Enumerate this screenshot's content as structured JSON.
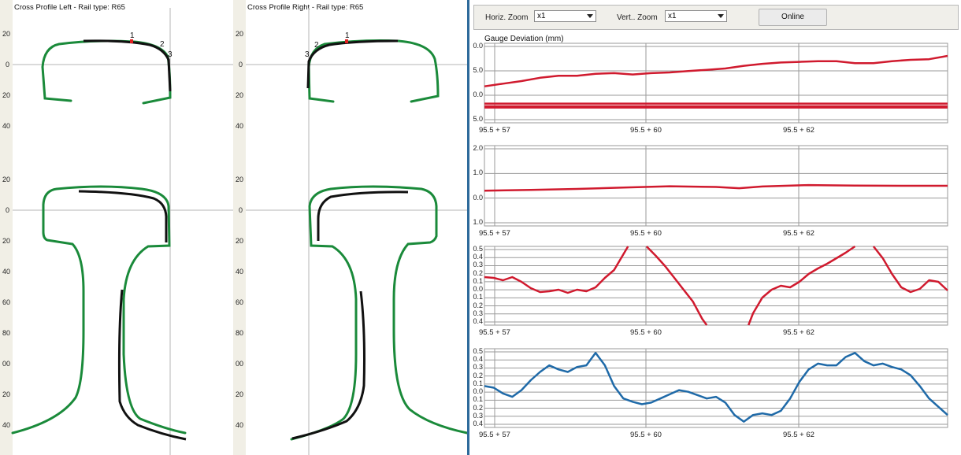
{
  "left_panel": {
    "title": "Cross Profile Left - Rail type: R65",
    "ticks_top": [
      "20",
      "0",
      "20",
      "40"
    ],
    "ticks_bottom": [
      "20",
      "0",
      "20",
      "40",
      "60",
      "80",
      "00",
      "20",
      "40"
    ],
    "markers": [
      "1",
      "2",
      "3"
    ]
  },
  "right_panel": {
    "title": "Cross Profile Right - Rail type: R65",
    "ticks_top": [
      "20",
      "0",
      "20",
      "40"
    ],
    "ticks_bottom": [
      "20",
      "0",
      "20",
      "40",
      "60",
      "80",
      "00",
      "20",
      "40"
    ],
    "markers": [
      "1",
      "2",
      "3"
    ]
  },
  "toolbar": {
    "horiz_label": "Horiz. Zoom",
    "horiz_value": "x1",
    "vert_label": "Vert.. Zoom",
    "vert_value": "x1",
    "online_label": "Online"
  },
  "colors": {
    "profile_green": "#1a8a3a",
    "measured_black": "#111111",
    "series_red": "#d01a2e",
    "series_blue": "#1f6aa8",
    "divider_blue": "#2d6a9b",
    "ruler_bg": "#f1efe6"
  },
  "chart_data": [
    {
      "type": "line",
      "title": "Gauge Deviation (mm)",
      "y_tick_labels": [
        "0.0",
        "5.0",
        "0.0",
        "5.0"
      ],
      "x_tick_labels": [
        "95.5 +  57",
        "95.5 +  60",
        "95.5 +  62"
      ],
      "series": [
        {
          "color": "#d01a2e",
          "x": [
            0,
            4,
            8,
            12,
            16,
            20,
            24,
            28,
            32,
            36,
            40,
            44,
            48,
            52,
            56,
            60,
            64,
            68,
            72,
            76,
            80,
            84,
            88,
            92,
            96,
            100
          ],
          "y": [
            2.0,
            2.4,
            2.8,
            3.3,
            3.6,
            3.6,
            3.9,
            4.0,
            3.8,
            4.0,
            4.1,
            4.3,
            4.5,
            4.7,
            5.1,
            5.4,
            5.6,
            5.7,
            5.8,
            5.8,
            5.5,
            5.5,
            5.8,
            6.0,
            6.1,
            6.6
          ]
        },
        {
          "color": "#d01a2e",
          "x": [
            0,
            100
          ],
          "y": [
            -0.6,
            -0.6
          ]
        },
        {
          "color": "#d01a2e",
          "x": [
            0,
            100
          ],
          "y": [
            -1.0,
            -1.0
          ]
        },
        {
          "color": "#d01a2e",
          "x": [
            0,
            100
          ],
          "y": [
            -1.2,
            -1.2
          ]
        }
      ]
    },
    {
      "type": "line",
      "y_tick_labels": [
        "2.0",
        "1.0",
        "0.0",
        "1.0"
      ],
      "x_tick_labels": [
        "95.5 +  57",
        "95.5 +  60",
        "95.5 +  62"
      ],
      "series": [
        {
          "color": "#d01a2e",
          "x": [
            0,
            10,
            20,
            30,
            40,
            50,
            55,
            60,
            70,
            80,
            90,
            100
          ],
          "y": [
            0.15,
            0.18,
            0.22,
            0.28,
            0.33,
            0.3,
            0.25,
            0.32,
            0.38,
            0.36,
            0.35,
            0.35
          ]
        }
      ]
    },
    {
      "type": "line",
      "y_tick_labels": [
        "0.5",
        "0.4",
        "0.3",
        "0.2",
        "0.1",
        "0.0",
        "0.1",
        "0.2",
        "0.3",
        "0.4"
      ],
      "x_tick_labels": [
        "95.5 +  57",
        "95.5 +  60",
        "95.5 +  62"
      ],
      "series": [
        {
          "color": "#d01a2e",
          "x": [
            0,
            2,
            4,
            6,
            8,
            10,
            12,
            14,
            16,
            18,
            20,
            22,
            24,
            26,
            28,
            30,
            31
          ],
          "y": [
            0.11,
            0.1,
            0.07,
            0.11,
            0.05,
            -0.03,
            -0.08,
            -0.07,
            -0.05,
            -0.09,
            -0.05,
            -0.07,
            -0.02,
            0.1,
            0.2,
            0.4,
            0.52
          ]
        },
        {
          "color": "#d01a2e",
          "x": [
            35,
            37,
            39,
            41,
            43,
            45,
            47,
            48
          ],
          "y": [
            0.52,
            0.38,
            0.25,
            0.1,
            -0.05,
            -0.2,
            -0.42,
            -0.52
          ]
        },
        {
          "color": "#d01a2e",
          "x": [
            57,
            58,
            60,
            62,
            64,
            66,
            68,
            70,
            72,
            74,
            76,
            78,
            80
          ],
          "y": [
            -0.52,
            -0.35,
            -0.15,
            -0.05,
            0.0,
            -0.02,
            0.05,
            0.15,
            0.22,
            0.28,
            0.35,
            0.42,
            0.52
          ]
        },
        {
          "color": "#d01a2e",
          "x": [
            84,
            86,
            88,
            90,
            92,
            94,
            96,
            98,
            100
          ],
          "y": [
            0.52,
            0.35,
            0.15,
            -0.02,
            -0.08,
            -0.04,
            0.07,
            0.05,
            -0.06
          ]
        }
      ]
    },
    {
      "type": "line",
      "y_tick_labels": [
        "0.5",
        "0.4",
        "0.3",
        "0.2",
        "0.1",
        "0.0",
        "0.1",
        "0.2",
        "0.3",
        "0.4"
      ],
      "x_tick_labels": [
        "95.5 +  57",
        "95.5 +  60",
        "95.5 +  62"
      ],
      "series": [
        {
          "color": "#1f6aa8",
          "x": [
            0,
            2,
            4,
            6,
            8,
            10,
            12,
            14,
            16,
            18,
            20,
            22,
            24,
            26,
            28,
            30,
            32,
            34,
            36,
            38,
            40,
            42,
            44,
            46,
            48,
            50,
            52,
            54,
            56,
            58,
            60,
            62,
            64,
            66,
            68,
            70,
            72,
            74,
            76,
            78,
            80,
            82,
            84,
            86,
            88,
            90,
            92,
            94,
            96,
            98,
            100
          ],
          "y": [
            0.05,
            0.03,
            -0.04,
            -0.08,
            0.0,
            0.12,
            0.22,
            0.3,
            0.25,
            0.22,
            0.28,
            0.3,
            0.45,
            0.3,
            0.05,
            -0.1,
            -0.14,
            -0.17,
            -0.15,
            -0.1,
            -0.05,
            0.0,
            -0.02,
            -0.06,
            -0.1,
            -0.08,
            -0.15,
            -0.3,
            -0.38,
            -0.3,
            -0.28,
            -0.3,
            -0.25,
            -0.1,
            0.1,
            0.25,
            0.32,
            0.3,
            0.3,
            0.4,
            0.45,
            0.35,
            0.3,
            0.32,
            0.28,
            0.25,
            0.18,
            0.05,
            -0.1,
            -0.2,
            -0.3
          ]
        }
      ]
    }
  ]
}
